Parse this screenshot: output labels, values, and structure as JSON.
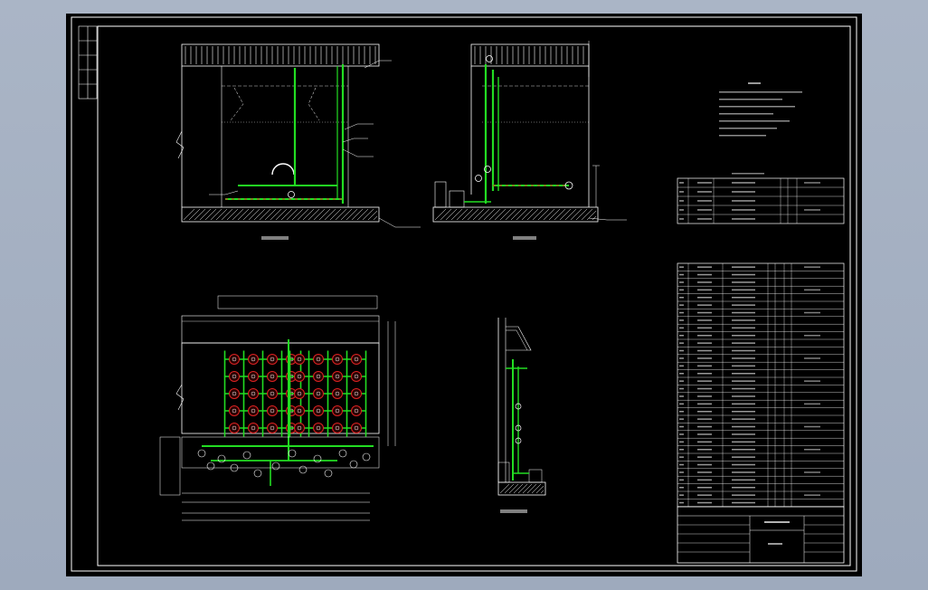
{
  "sheet": {
    "background": "#000000",
    "line_color": "#ffffff",
    "pipe_color": "#22dd22",
    "accent_color": "#dd2222"
  },
  "views": [
    {
      "id": "elevation-a",
      "caption": ""
    },
    {
      "id": "elevation-b",
      "caption": ""
    },
    {
      "id": "plan",
      "caption": ""
    },
    {
      "id": "section",
      "caption": ""
    }
  ],
  "notes": {
    "lines": []
  },
  "equipment_table": {
    "row_count": 5
  },
  "materials_table": {
    "row_count": 32
  },
  "title_block": {
    "fields": []
  }
}
